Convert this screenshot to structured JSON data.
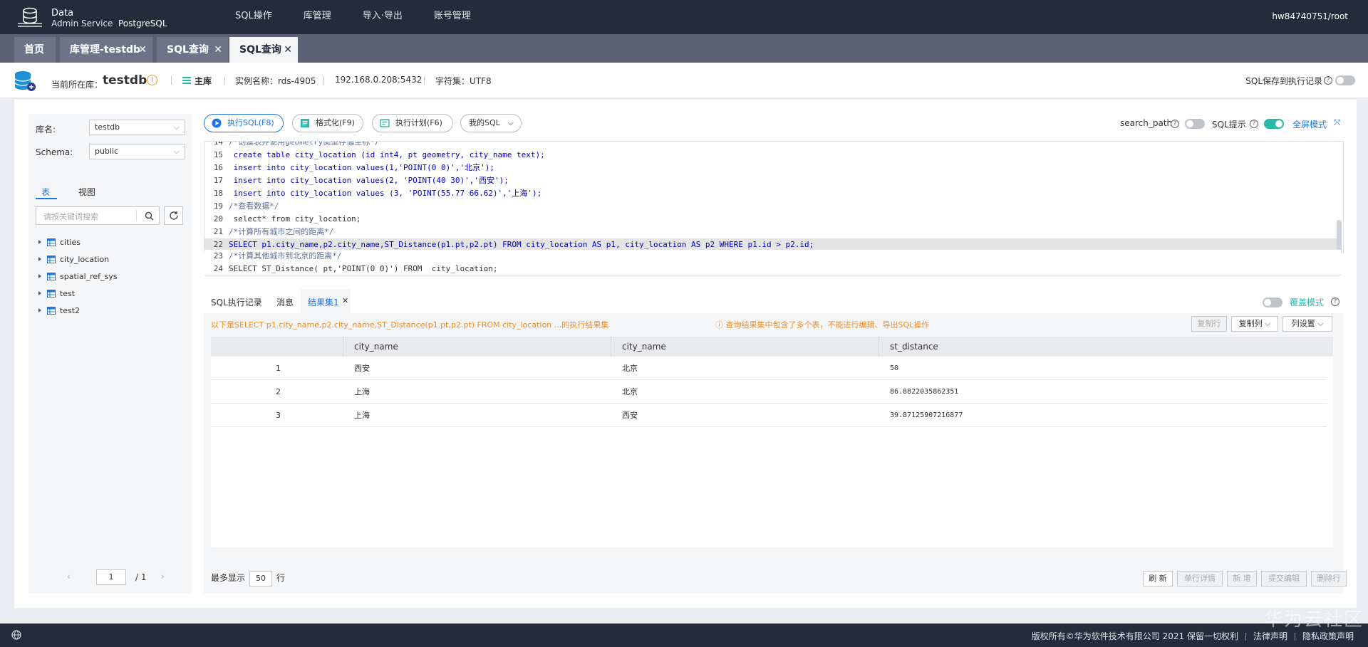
{
  "header": {
    "logo_line1": "Data",
    "logo_line2": "Admin Service",
    "logo_line3": "PostgreSQL",
    "menu": [
      "SQL操作",
      "库管理",
      "导入·导出",
      "账号管理"
    ],
    "user": "hw84740751/root"
  },
  "tabs": [
    {
      "label": "首页",
      "closable": false
    },
    {
      "label": "库管理-testdb",
      "closable": true
    },
    {
      "label": "SQL查询",
      "closable": true
    },
    {
      "label": "SQL查询",
      "closable": true,
      "active": true
    }
  ],
  "infobar": {
    "current_db_label": "当前所在库：",
    "current_db": "testdb",
    "role": "主库",
    "instance": "实例名称：rds-4905",
    "address": "192.168.0.208:5432",
    "charset": "字符集：UTF8",
    "save_sql_label": "SQL保存到执行记录"
  },
  "left": {
    "db_label": "库名:",
    "db_value": "testdb",
    "schema_label": "Schema:",
    "schema_value": "public",
    "tab_table": "表",
    "tab_view": "视图",
    "search_placeholder": "请按关键词搜索",
    "tables": [
      "cities",
      "city_location",
      "spatial_ref_sys",
      "test",
      "test2"
    ],
    "page_current": "1",
    "page_total": "/ 1"
  },
  "toolbar": {
    "execute": "执行SQL(F8)",
    "format": "格式化(F9)",
    "plan": "执行计划(F6)",
    "mysql": "我的SQL",
    "search_path": "search_path",
    "sql_hint": "SQL提示",
    "fullscreen": "全屏模式"
  },
  "editor": {
    "lines": [
      {
        "n": "14",
        "text": "/*创建表并使用geometry类型存储坐标*/",
        "partial": true
      },
      {
        "n": "15",
        "text": " create table city_location (id int4, pt geometry, city_name text);"
      },
      {
        "n": "16",
        "text": " insert into city_location values(1,'POINT(0 0)','北京');"
      },
      {
        "n": "17",
        "text": " insert into city_location values(2, 'POINT(40 30)','西安');"
      },
      {
        "n": "18",
        "text": " insert into city_location values (3, 'POINT(55.77 66.62)','上海');"
      },
      {
        "n": "19",
        "text": "/*查看数据*/"
      },
      {
        "n": "20",
        "text": " select* from city_location;"
      },
      {
        "n": "21",
        "text": "/*计算所有城市之间的距离*/"
      },
      {
        "n": "22",
        "text": "SELECT p1.city_name,p2.city_name,ST_Distance(p1.pt,p2.pt) FROM city_location AS p1, city_location AS p2 WHERE p1.id > p2.id;",
        "highlight": true
      },
      {
        "n": "23",
        "text": "/*计算其他城市到北京的距离*/"
      },
      {
        "n": "24",
        "text": "SELECT ST_Distance( pt,'POINT(0 0)') FROM  city_location;"
      }
    ]
  },
  "result_tabs": {
    "history": "SQL执行记录",
    "messages": "消息",
    "result": "结果集1",
    "overwrite": "覆盖模式"
  },
  "result": {
    "notice_left": "以下是SELECT p1.city_name,p2.city_name,ST_Distance(p1.pt,p2.pt) FROM city_location ...的执行结果集",
    "notice_right": "查询结果集中包含了多个表，不能进行编辑、导出SQL操作",
    "btn_copy_row": "复制行",
    "btn_copy_col": "复制列",
    "btn_col_settings": "列设置",
    "columns": [
      "city_name",
      "city_name",
      "st_distance"
    ],
    "rows": [
      {
        "idx": "1",
        "c1": "西安",
        "c2": "北京",
        "c3": "50"
      },
      {
        "idx": "2",
        "c1": "上海",
        "c2": "北京",
        "c3": "86.8822035862351"
      },
      {
        "idx": "3",
        "c1": "上海",
        "c2": "西安",
        "c3": "39.87125907216877"
      }
    ],
    "max_show_label": "最多显示",
    "max_show_value": "50",
    "max_show_unit": "行",
    "btn_refresh": "刷 新",
    "btn_row_detail": "单行详情",
    "btn_new": "新 增",
    "btn_submit": "提交编辑",
    "btn_delete": "删除行"
  },
  "footer": {
    "copyright": "版权所有©华为软件技术有限公司 2021 保留一切权利",
    "legal": "法律声明",
    "privacy": "隐私政策声明",
    "watermark": "华为云社区"
  },
  "colors": {
    "nav": "#252b3a",
    "tabbar": "#5b6275",
    "accent": "#1e74e6",
    "toggle_on": "#2ab8a9",
    "notice": "#f08c25"
  }
}
